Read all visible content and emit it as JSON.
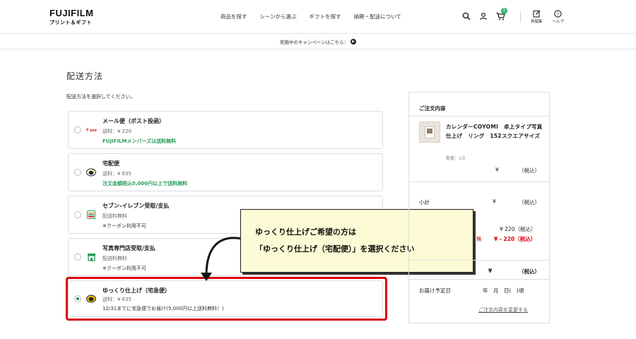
{
  "header": {
    "logo_main": "FUJIFILM",
    "logo_sub": "プリント＆ギフト",
    "nav": [
      "商品を探す",
      "シーンから選ぶ",
      "ギフトを探す",
      "納期・配送について"
    ],
    "cart_count": "1",
    "icon_labels": {
      "reorder": "再編集",
      "help": "ヘルプ"
    }
  },
  "campaign": {
    "text": "実施中のキャンペーンはこちら："
  },
  "page": {
    "title": "配送方法",
    "instruction": "配送方法を選択してください。"
  },
  "options": [
    {
      "name": "メール便（ポスト投函）",
      "fee": "送料：¥ 220",
      "note": "FUJIFILMメンバーズは送料無料",
      "carrier_icon": "japan-post-icon",
      "selected": false
    },
    {
      "name": "宅配便",
      "fee": "送料：¥ 635",
      "note": "注文金額税込5,000円以上で送料無料",
      "carrier_icon": "yamato-cat-icon",
      "selected": false
    },
    {
      "name": "セブン-イレブン受取/支払",
      "fee": "配送料無料",
      "note": "※クーポン利用不可",
      "carrier_icon": "seven-eleven-icon",
      "selected": false
    },
    {
      "name": "写真専門店受取/支払",
      "fee": "配送料無料",
      "note": "※クーポン利用不可",
      "carrier_icon": "shop-icon",
      "selected": false
    },
    {
      "name": "ゆっくり仕上げ（宅急便）",
      "fee": "送料：¥ 635",
      "note": "12/31までに宅急便でお届け(5,000円以上送料無料！)",
      "carrier_icon": "yamato-cat-icon",
      "selected": true
    }
  ],
  "callout": {
    "line1": "ゆっくり仕上げご希望の方は",
    "line2": "「ゆっくり仕上げ（宅配便）」を選択ください"
  },
  "summary": {
    "title": "ご注文内容",
    "product_name": "カレンダーCOYOMI　卓上タイプ写真仕上げ　リング　152スクエアサイズ",
    "quantity": "数量：1点",
    "item_price": "¥",
    "tax_incl": "（税込）",
    "subtotal_label": "小計",
    "subtotal_value": "¥",
    "subtotal_tax": "（税込）",
    "shipping_value": "¥ 220（税込）",
    "free_label": "無",
    "discount_value": "¥ - 220（税込）",
    "total_value": "¥",
    "total_tax": "（税込）",
    "delivery_label": "お届け予定日",
    "delivery_date": "年　月　日(　)頃",
    "change_link": "ご注文内容を変更する"
  },
  "colors": {
    "accent_green": "#2a9d5c",
    "highlight_red": "#d9000d",
    "callout_bg": "#fdfbd5"
  }
}
